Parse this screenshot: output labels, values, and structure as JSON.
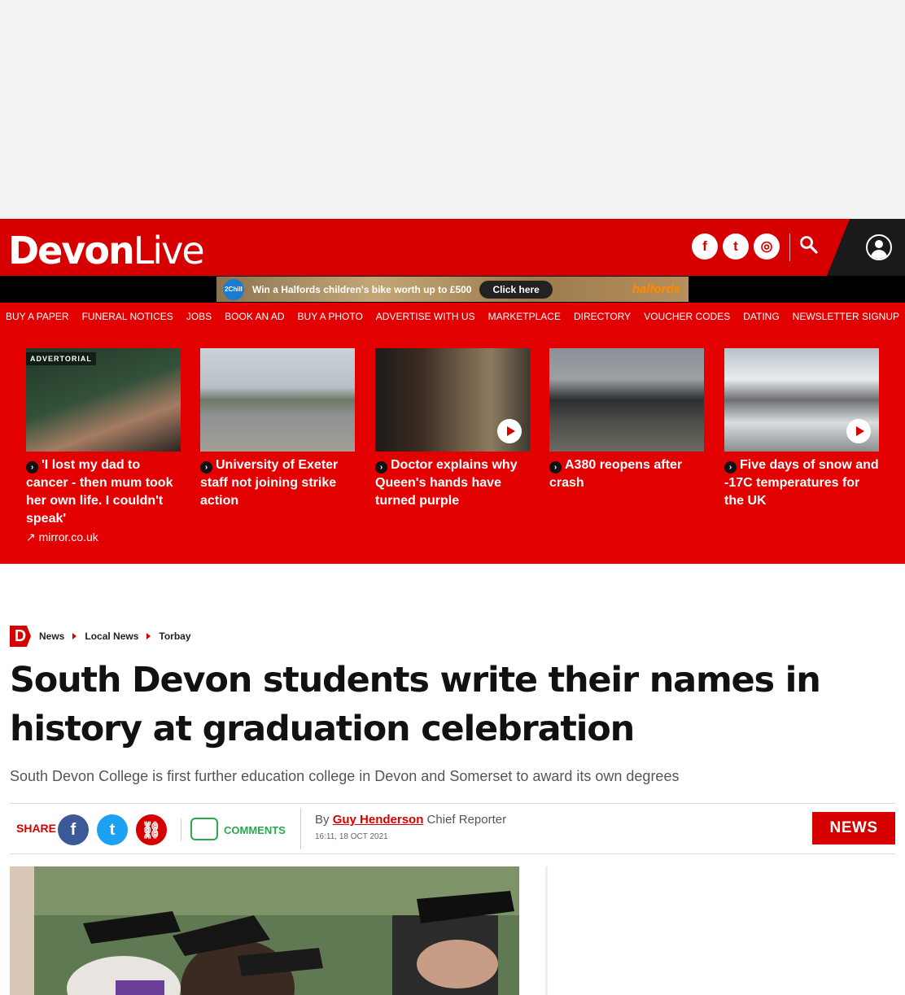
{
  "brand": {
    "name_bold": "Devon",
    "name_light": "Live"
  },
  "socials": [
    {
      "icon": "facebook-icon",
      "glyph": "f"
    },
    {
      "icon": "twitter-icon",
      "glyph": "t"
    },
    {
      "icon": "instagram-icon",
      "glyph": "◎"
    }
  ],
  "banner_ad": {
    "badge": "2Chill",
    "text": "Win a Halfords children's bike worth up to £500",
    "cta": "Click here",
    "brand": "halfords"
  },
  "nav": [
    "BUY A PAPER",
    "FUNERAL NOTICES",
    "JOBS",
    "BOOK AN AD",
    "BUY A PHOTO",
    "ADVERTISE WITH US",
    "MARKETPLACE",
    "DIRECTORY",
    "VOUCHER CODES",
    "DATING",
    "NEWSLETTER SIGNUP"
  ],
  "promo_cards": [
    {
      "badge": "ADVERTORIAL",
      "title": "'I lost my dad to cancer - then mum took her own life. I couldn't speak'",
      "source": "mirror.co.uk",
      "video": false
    },
    {
      "badge": "",
      "title": "University of Exeter staff not joining strike action",
      "source": "",
      "video": false
    },
    {
      "badge": "",
      "title": "Doctor explains why Queen's hands have turned purple",
      "source": "",
      "video": true
    },
    {
      "badge": "",
      "title": "A380 reopens after crash",
      "source": "",
      "video": false
    },
    {
      "badge": "",
      "title": "Five days of snow and -17C temperatures for the UK",
      "source": "",
      "video": true
    }
  ],
  "breadcrumb": [
    "News",
    "Local News",
    "Torbay"
  ],
  "article": {
    "headline": "South Devon students write their names in history at graduation celebration",
    "standfirst": "South Devon College is first further education college in Devon and Somerset to award its own degrees",
    "share_label": "SHARE",
    "comments_label": "COMMENTS",
    "by": "By",
    "author": "Guy Henderson",
    "role": "Chief Reporter",
    "timestamp": "16:11, 18 OCT 2021",
    "tag": "NEWS"
  },
  "colors": {
    "brand_red": "#d70000",
    "nav_red": "#e30000",
    "comments_green": "#2aa84a"
  }
}
